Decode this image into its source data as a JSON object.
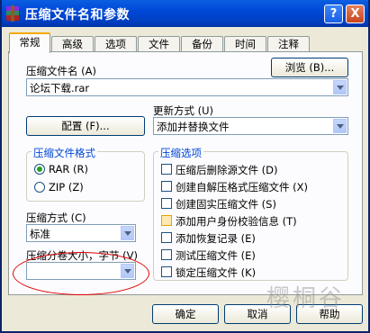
{
  "window": {
    "title": "压缩文件名和参数",
    "help_glyph": "?",
    "close_glyph": "X"
  },
  "tabs": [
    "常规",
    "高级",
    "选项",
    "文件",
    "备份",
    "时间",
    "注释"
  ],
  "archive_name": {
    "label": "压缩文件名 (A)",
    "browse_label": "浏览 (B)...",
    "value": "论坛下载.rar"
  },
  "update_mode": {
    "label": "更新方式 (U)",
    "value": "添加并替换文件"
  },
  "profiles_button": "配置 (F)...",
  "archive_format": {
    "title": "压缩文件格式",
    "options": [
      "RAR (R)",
      "ZIP (Z)"
    ],
    "selected": "RAR (R)"
  },
  "compression_method": {
    "label": "压缩方式 (C)",
    "value": "标准"
  },
  "volume_size": {
    "label": "压缩分卷大小，字节 (V)",
    "value": ""
  },
  "archive_options": {
    "title": "压缩选项",
    "items": [
      {
        "label": "压缩后删除源文件 (D)",
        "checked": false
      },
      {
        "label": "创建自解压格式压缩文件 (X)",
        "checked": false
      },
      {
        "label": "创建固实压缩文件 (S)",
        "checked": false
      },
      {
        "label": "添加用户身份校验信息 (T)",
        "checked": false
      },
      {
        "label": "添加恢复记录 (E)",
        "checked": false
      },
      {
        "label": "测试压缩文件 (E)",
        "checked": false
      },
      {
        "label": "锁定压缩文件 (K)",
        "checked": false
      }
    ]
  },
  "buttons": {
    "ok": "确定",
    "cancel": "取消",
    "help": "帮助"
  },
  "watermark": "樱桐谷"
}
